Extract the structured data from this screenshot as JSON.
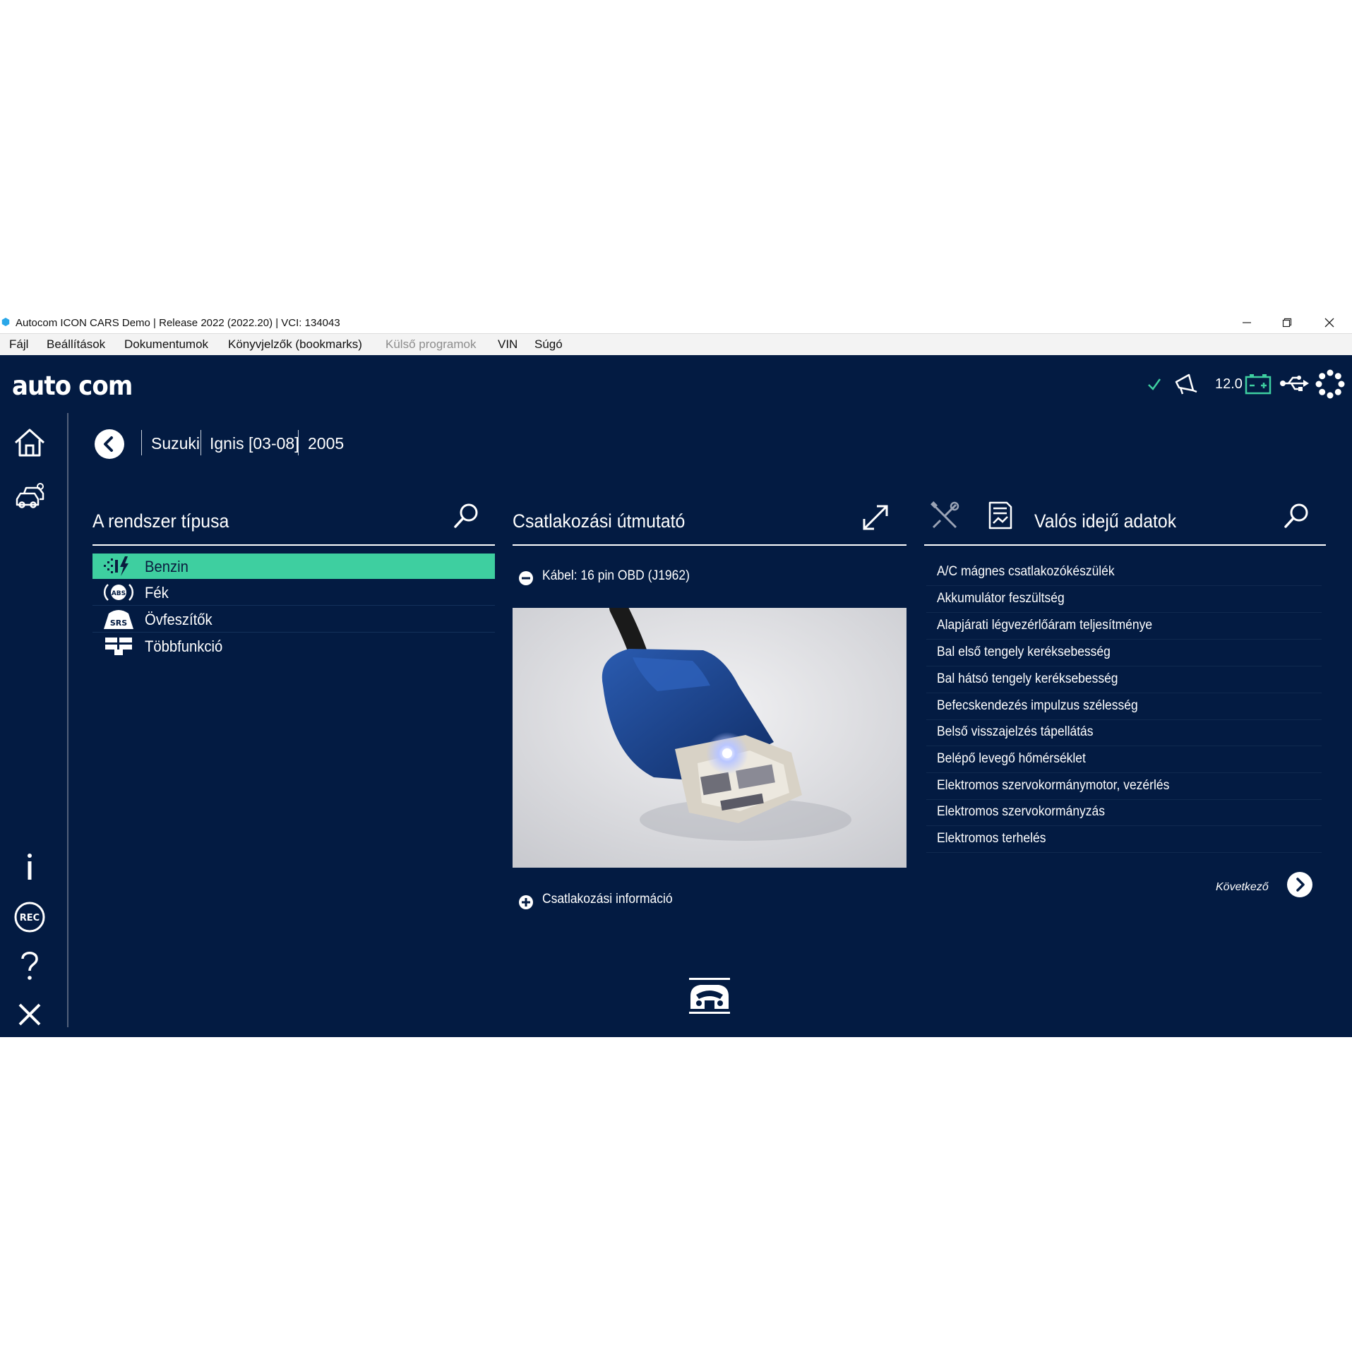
{
  "window": {
    "title": "Autocom ICON CARS Demo |  Release 2022 (2022.20)  |  VCI: 134043"
  },
  "menu": [
    {
      "label": "Fájl",
      "enabled": true
    },
    {
      "label": "Beállítások",
      "enabled": true
    },
    {
      "label": "Dokumentumok",
      "enabled": true
    },
    {
      "label": "Könyvjelzők (bookmarks)",
      "enabled": true
    },
    {
      "label": "Külső programok",
      "enabled": false
    },
    {
      "label": "VIN",
      "enabled": true
    },
    {
      "label": "Súgó",
      "enabled": true
    }
  ],
  "header": {
    "logo": "auto com",
    "voltage": "12.0",
    "status_ok_icon": "check-icon",
    "accent_color": "#3ecfa0"
  },
  "breadcrumb": [
    "Suzuki",
    "Ignis [03-08]",
    "2005"
  ],
  "system_panel": {
    "title": "A rendszer típusa",
    "items": [
      {
        "label": "Benzin",
        "icon": "fuel-injection-icon",
        "selected": true
      },
      {
        "label": "Fék",
        "icon": "abs-icon",
        "selected": false
      },
      {
        "label": "Övfeszítők",
        "icon": "srs-icon",
        "selected": false
      },
      {
        "label": "Többfunkció",
        "icon": "multifunction-icon",
        "selected": false
      }
    ]
  },
  "connection_panel": {
    "title": "Csatlakozási útmutató",
    "cable": "Kábel: 16 pin OBD (J1962)",
    "info": "Csatlakozási információ"
  },
  "realtime_panel": {
    "title": "Valós idejű adatok",
    "items": [
      "A/C mágnes csatlakozókészülék",
      "Akkumulátor feszültség",
      "Alapjárati légvezérlőáram teljesítménye",
      "Bal első tengely keréksebesség",
      "Bal hátsó tengely keréksebesség",
      "Befecskendezés impulzus szélesség",
      "Belső visszajelzés tápellátás",
      "Belépő levegő hőmérséklet",
      "Elektromos szervokormánymotor, vezérlés",
      "Elektromos szervokormányzás",
      "Elektromos terhelés"
    ],
    "next_label": "Következő"
  }
}
